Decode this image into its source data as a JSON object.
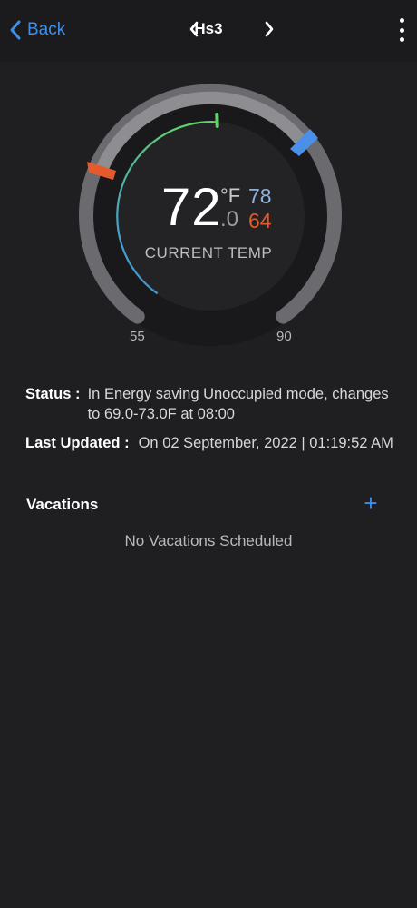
{
  "header": {
    "back_label": "Back",
    "device_name": "Hs3",
    "icons": [
      "chevron-left-icon",
      "chevron-right-icon",
      "more-vertical-icon"
    ],
    "accent_color": "#3f8ee8"
  },
  "thermostat": {
    "current_temp_whole": "72",
    "current_temp_decimal": ".0",
    "unit": "°F",
    "cool_setpoint": "78",
    "heat_setpoint": "64",
    "label": "CURRENT TEMP",
    "range_min": "55",
    "range_max": "90",
    "colors": {
      "cool": "#4a8fe8",
      "heat": "#e55a2c",
      "current_marker": "#5fd36a"
    }
  },
  "status": {
    "label": "Status :",
    "value": "In Energy saving Unoccupied mode, changes to 69.0-73.0F at 08:00"
  },
  "last_updated": {
    "label": "Last Updated :",
    "value": "On 02 September, 2022 | 01:19:52 AM"
  },
  "vacations": {
    "label": "Vacations",
    "add_label": "+",
    "empty_text": "No Vacations Scheduled"
  }
}
